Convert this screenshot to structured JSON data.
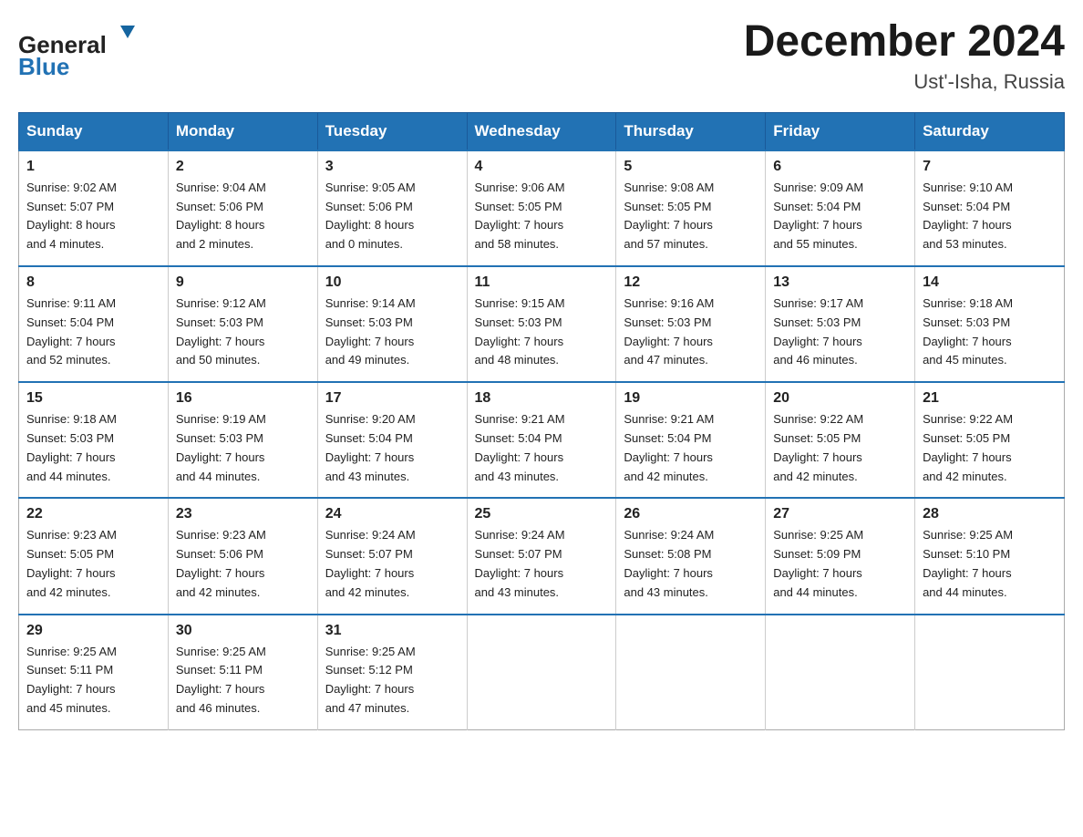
{
  "header": {
    "logo_line1": "General",
    "logo_line2": "Blue",
    "title": "December 2024",
    "subtitle": "Ust'-Isha, Russia"
  },
  "calendar": {
    "days_of_week": [
      "Sunday",
      "Monday",
      "Tuesday",
      "Wednesday",
      "Thursday",
      "Friday",
      "Saturday"
    ],
    "weeks": [
      [
        {
          "day": "1",
          "sunrise": "9:02 AM",
          "sunset": "5:07 PM",
          "daylight_hours": "8",
          "daylight_minutes": "4"
        },
        {
          "day": "2",
          "sunrise": "9:04 AM",
          "sunset": "5:06 PM",
          "daylight_hours": "8",
          "daylight_minutes": "2"
        },
        {
          "day": "3",
          "sunrise": "9:05 AM",
          "sunset": "5:06 PM",
          "daylight_hours": "8",
          "daylight_minutes": "0"
        },
        {
          "day": "4",
          "sunrise": "9:06 AM",
          "sunset": "5:05 PM",
          "daylight_hours": "7",
          "daylight_minutes": "58"
        },
        {
          "day": "5",
          "sunrise": "9:08 AM",
          "sunset": "5:05 PM",
          "daylight_hours": "7",
          "daylight_minutes": "57"
        },
        {
          "day": "6",
          "sunrise": "9:09 AM",
          "sunset": "5:04 PM",
          "daylight_hours": "7",
          "daylight_minutes": "55"
        },
        {
          "day": "7",
          "sunrise": "9:10 AM",
          "sunset": "5:04 PM",
          "daylight_hours": "7",
          "daylight_minutes": "53"
        }
      ],
      [
        {
          "day": "8",
          "sunrise": "9:11 AM",
          "sunset": "5:04 PM",
          "daylight_hours": "7",
          "daylight_minutes": "52"
        },
        {
          "day": "9",
          "sunrise": "9:12 AM",
          "sunset": "5:03 PM",
          "daylight_hours": "7",
          "daylight_minutes": "50"
        },
        {
          "day": "10",
          "sunrise": "9:14 AM",
          "sunset": "5:03 PM",
          "daylight_hours": "7",
          "daylight_minutes": "49"
        },
        {
          "day": "11",
          "sunrise": "9:15 AM",
          "sunset": "5:03 PM",
          "daylight_hours": "7",
          "daylight_minutes": "48"
        },
        {
          "day": "12",
          "sunrise": "9:16 AM",
          "sunset": "5:03 PM",
          "daylight_hours": "7",
          "daylight_minutes": "47"
        },
        {
          "day": "13",
          "sunrise": "9:17 AM",
          "sunset": "5:03 PM",
          "daylight_hours": "7",
          "daylight_minutes": "46"
        },
        {
          "day": "14",
          "sunrise": "9:18 AM",
          "sunset": "5:03 PM",
          "daylight_hours": "7",
          "daylight_minutes": "45"
        }
      ],
      [
        {
          "day": "15",
          "sunrise": "9:18 AM",
          "sunset": "5:03 PM",
          "daylight_hours": "7",
          "daylight_minutes": "44"
        },
        {
          "day": "16",
          "sunrise": "9:19 AM",
          "sunset": "5:03 PM",
          "daylight_hours": "7",
          "daylight_minutes": "44"
        },
        {
          "day": "17",
          "sunrise": "9:20 AM",
          "sunset": "5:04 PM",
          "daylight_hours": "7",
          "daylight_minutes": "43"
        },
        {
          "day": "18",
          "sunrise": "9:21 AM",
          "sunset": "5:04 PM",
          "daylight_hours": "7",
          "daylight_minutes": "43"
        },
        {
          "day": "19",
          "sunrise": "9:21 AM",
          "sunset": "5:04 PM",
          "daylight_hours": "7",
          "daylight_minutes": "42"
        },
        {
          "day": "20",
          "sunrise": "9:22 AM",
          "sunset": "5:05 PM",
          "daylight_hours": "7",
          "daylight_minutes": "42"
        },
        {
          "day": "21",
          "sunrise": "9:22 AM",
          "sunset": "5:05 PM",
          "daylight_hours": "7",
          "daylight_minutes": "42"
        }
      ],
      [
        {
          "day": "22",
          "sunrise": "9:23 AM",
          "sunset": "5:05 PM",
          "daylight_hours": "7",
          "daylight_minutes": "42"
        },
        {
          "day": "23",
          "sunrise": "9:23 AM",
          "sunset": "5:06 PM",
          "daylight_hours": "7",
          "daylight_minutes": "42"
        },
        {
          "day": "24",
          "sunrise": "9:24 AM",
          "sunset": "5:07 PM",
          "daylight_hours": "7",
          "daylight_minutes": "42"
        },
        {
          "day": "25",
          "sunrise": "9:24 AM",
          "sunset": "5:07 PM",
          "daylight_hours": "7",
          "daylight_minutes": "43"
        },
        {
          "day": "26",
          "sunrise": "9:24 AM",
          "sunset": "5:08 PM",
          "daylight_hours": "7",
          "daylight_minutes": "43"
        },
        {
          "day": "27",
          "sunrise": "9:25 AM",
          "sunset": "5:09 PM",
          "daylight_hours": "7",
          "daylight_minutes": "44"
        },
        {
          "day": "28",
          "sunrise": "9:25 AM",
          "sunset": "5:10 PM",
          "daylight_hours": "7",
          "daylight_minutes": "44"
        }
      ],
      [
        {
          "day": "29",
          "sunrise": "9:25 AM",
          "sunset": "5:11 PM",
          "daylight_hours": "7",
          "daylight_minutes": "45"
        },
        {
          "day": "30",
          "sunrise": "9:25 AM",
          "sunset": "5:11 PM",
          "daylight_hours": "7",
          "daylight_minutes": "46"
        },
        {
          "day": "31",
          "sunrise": "9:25 AM",
          "sunset": "5:12 PM",
          "daylight_hours": "7",
          "daylight_minutes": "47"
        },
        null,
        null,
        null,
        null
      ]
    ]
  }
}
